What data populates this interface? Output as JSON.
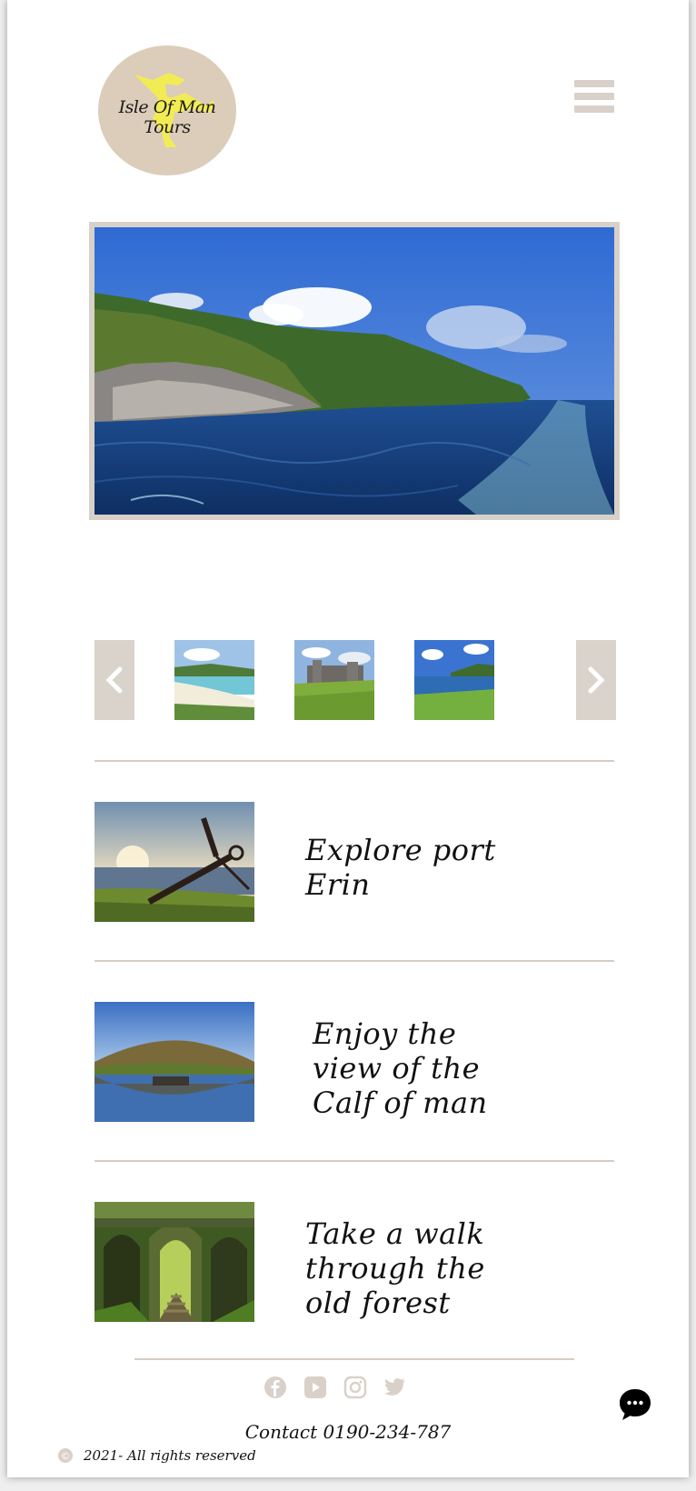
{
  "header": {
    "logo_text": "Isle Of Man Tours"
  },
  "colors": {
    "accent": "#d9d1c9",
    "logo_bg": "#dbcdb9",
    "triskelion": "#f1ec54",
    "text": "#111111"
  },
  "icons": {
    "menu": "hamburger-icon",
    "prev": "chevron-left-icon",
    "next": "chevron-right-icon",
    "chat": "chat-bubble-icon",
    "copyright": "copyright-icon"
  },
  "tours": [
    {
      "title": "Explore port Erin"
    },
    {
      "title": "Enjoy the view of the Calf of man"
    },
    {
      "title": "Take a walk through the old forest"
    }
  ],
  "footer": {
    "socials": [
      "facebook-icon",
      "youtube-icon",
      "instagram-icon",
      "twitter-icon"
    ],
    "contact": "Contact 0190-234-787",
    "copyright": "2021- All rights reserved"
  }
}
